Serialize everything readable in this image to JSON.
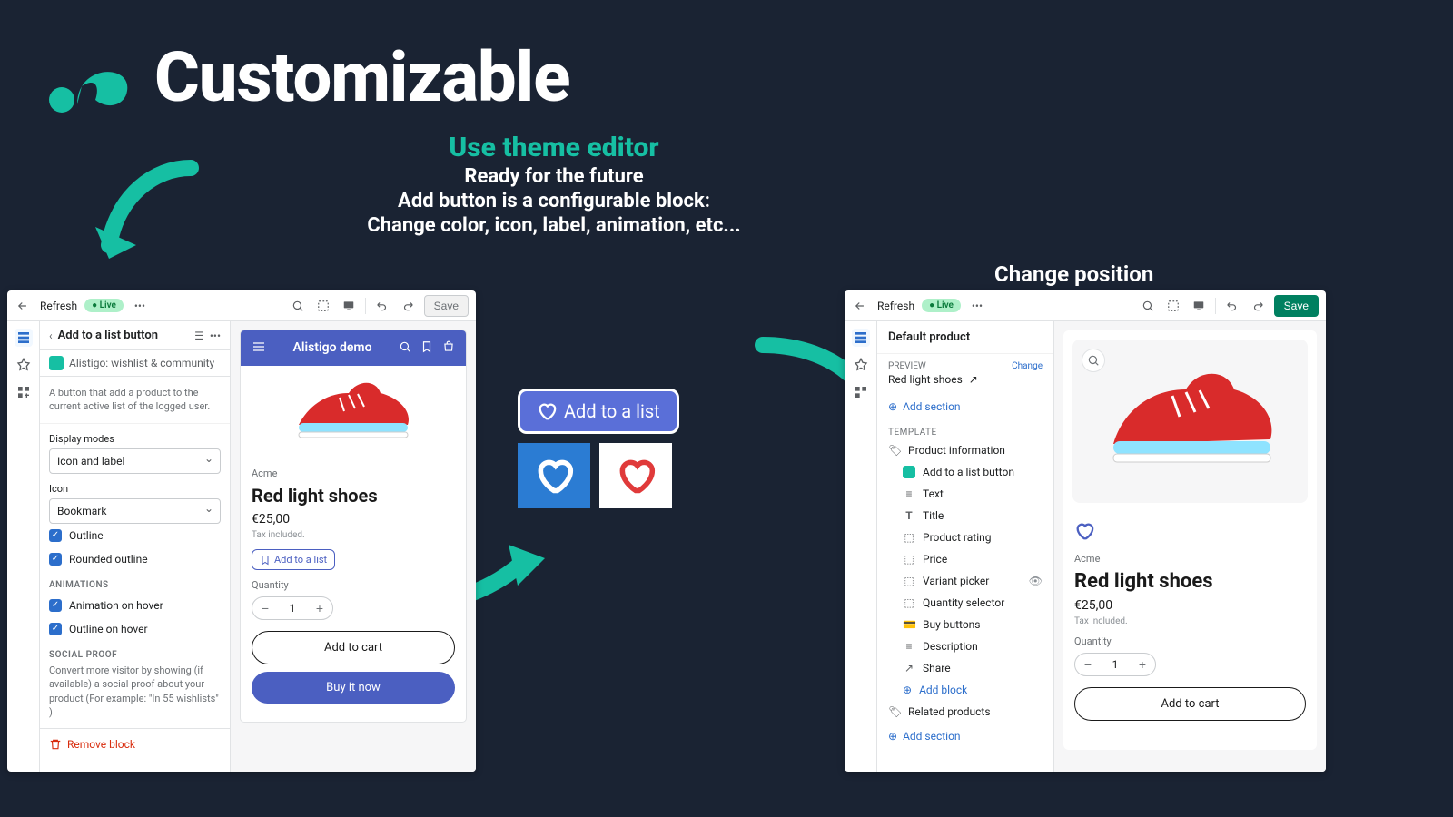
{
  "hero": {
    "title": "Customizable"
  },
  "subtitles": {
    "use": "Use theme editor",
    "l1": "Ready for the future",
    "l2": "Add button is a configurable block:",
    "l3": "Change color, icon, label, animation, etc..."
  },
  "change_position": "Change position",
  "editor": {
    "refresh": "Refresh",
    "live": "Live",
    "save": "Save"
  },
  "left_panel": {
    "title": "Add to a list button",
    "app_name": "Alistigo: wishlist & community",
    "description": "A button that add a product to the current active list of the logged user.",
    "display_modes_label": "Display modes",
    "display_modes_value": "Icon and label",
    "icon_label": "Icon",
    "icon_value": "Bookmark",
    "outline": "Outline",
    "rounded_outline": "Rounded outline",
    "animations_section": "ANIMATIONS",
    "anim_hover": "Animation on hover",
    "outline_hover": "Outline on hover",
    "social_section": "SOCIAL PROOF",
    "social_desc": "Convert more visitor by showing (if available) a social proof about your product (For example: \"In 55 wishlists\" )",
    "remove": "Remove block"
  },
  "right_panel": {
    "title": "Default product",
    "preview_label": "PREVIEW",
    "change": "Change",
    "preview_name": "Red light shoes",
    "add_section": "Add section",
    "template_label": "TEMPLATE",
    "items": {
      "product_info": "Product information",
      "add_list": "Add to a list button",
      "text": "Text",
      "title": "Title",
      "rating": "Product rating",
      "price": "Price",
      "variant": "Variant picker",
      "qty": "Quantity selector",
      "buy": "Buy buttons",
      "desc": "Description",
      "share": "Share",
      "add_block": "Add block",
      "related": "Related products"
    }
  },
  "product": {
    "brand": "Alistigo demo",
    "vendor": "Acme",
    "title": "Red light shoes",
    "price": "€25,00",
    "tax": "Tax included.",
    "add_to_list": "Add to a list",
    "quantity_label": "Quantity",
    "qty_value": "1",
    "add_to_cart": "Add to cart",
    "buy_now": "Buy it now"
  },
  "strip": {
    "pill": "Add to a list"
  }
}
